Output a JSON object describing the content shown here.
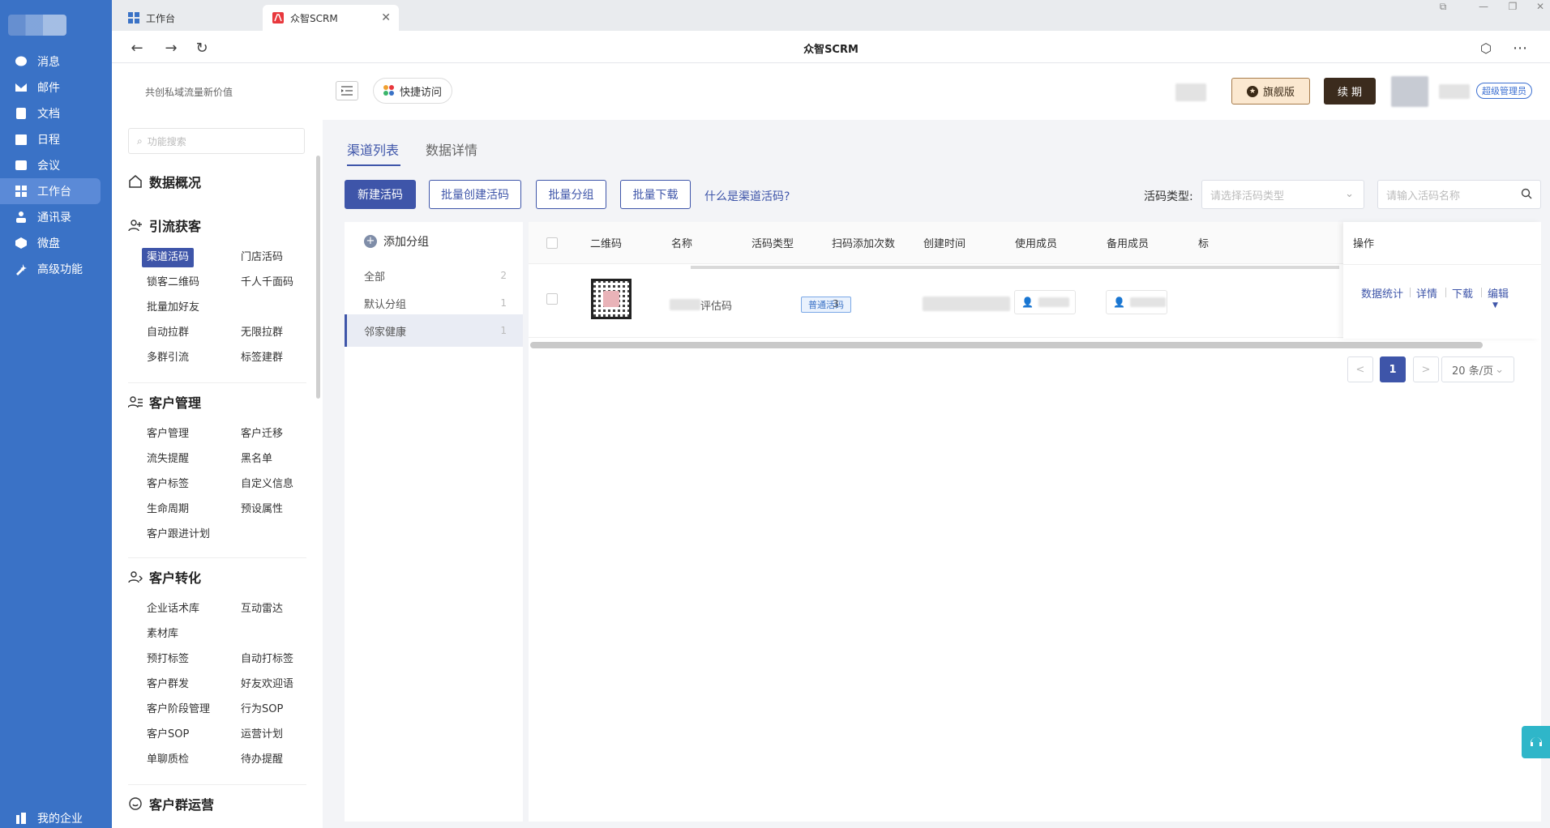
{
  "rail": {
    "items": [
      {
        "label": "消息",
        "icon": "message-icon"
      },
      {
        "label": "邮件",
        "icon": "mail-icon"
      },
      {
        "label": "文档",
        "icon": "document-icon"
      },
      {
        "label": "日程",
        "icon": "calendar-icon"
      },
      {
        "label": "会议",
        "icon": "meeting-icon"
      },
      {
        "label": "工作台",
        "icon": "grid-icon"
      },
      {
        "label": "通讯录",
        "icon": "contacts-icon"
      },
      {
        "label": "微盘",
        "icon": "disk-icon"
      },
      {
        "label": "高级功能",
        "icon": "advanced-icon"
      }
    ],
    "bottom_label": "我的企业"
  },
  "browser": {
    "tabs": [
      {
        "label": "工作台"
      },
      {
        "label": "众智SCRM"
      }
    ],
    "page_title": "众智SCRM"
  },
  "header": {
    "slogan": "共创私域流量新价值",
    "quick_access": "快捷访问",
    "flagship": "旗舰版",
    "renew": "续 期",
    "role": "超级管理员"
  },
  "sidenav": {
    "search_placeholder": "功能搜索",
    "overview": "数据概况",
    "sections": [
      {
        "title": "引流获客",
        "links": [
          "渠道活码",
          "门店活码",
          "锁客二维码",
          "千人千面码",
          "批量加好友",
          "自动拉群",
          "无限拉群",
          "多群引流",
          "标签建群"
        ]
      },
      {
        "title": "客户管理",
        "links": [
          "客户管理",
          "客户迁移",
          "流失提醒",
          "黑名单",
          "客户标签",
          "自定义信息",
          "生命周期",
          "预设属性",
          "客户跟进计划"
        ]
      },
      {
        "title": "客户转化",
        "links": [
          "企业话术库",
          "互动雷达",
          "素材库",
          "预打标签",
          "自动打标签",
          "客户群发",
          "好友欢迎语",
          "客户阶段管理",
          "行为SOP",
          "客户SOP",
          "运营计划",
          "单聊质检",
          "待办提醒"
        ]
      },
      {
        "title": "客户群运营",
        "links": []
      }
    ]
  },
  "main": {
    "tabs": [
      "渠道列表",
      "数据详情"
    ],
    "buttons": {
      "new": "新建活码",
      "batch_create": "批量创建活码",
      "batch_group": "批量分组",
      "batch_download": "批量下载"
    },
    "what_is": "什么是渠道活码?",
    "type_label": "活码类型:",
    "type_placeholder": "请选择活码类型",
    "name_placeholder": "请输入活码名称",
    "groups": {
      "add": "添加分组",
      "items": [
        {
          "label": "全部",
          "count": "2"
        },
        {
          "label": "默认分组",
          "count": "1"
        },
        {
          "label": "邻家健康",
          "count": "1"
        }
      ]
    },
    "table": {
      "headers": [
        "二维码",
        "名称",
        "活码类型",
        "扫码添加次数",
        "创建时间",
        "使用成员",
        "备用成员",
        "标",
        "操作"
      ],
      "rows": [
        {
          "name_suffix": "评估码",
          "type": "普通活码",
          "scans": "3"
        }
      ],
      "actions": [
        "数据统计",
        "详情",
        "下载",
        "编辑"
      ]
    },
    "pagination": {
      "prev": "<",
      "current": "1",
      "next": ">",
      "page_size": "20 条/页"
    }
  },
  "colors": {
    "rail": "#3a72c6",
    "primary": "#3e55a9",
    "renew_bg": "#3b2b1d",
    "flagship_bg": "#fbe8d0"
  }
}
